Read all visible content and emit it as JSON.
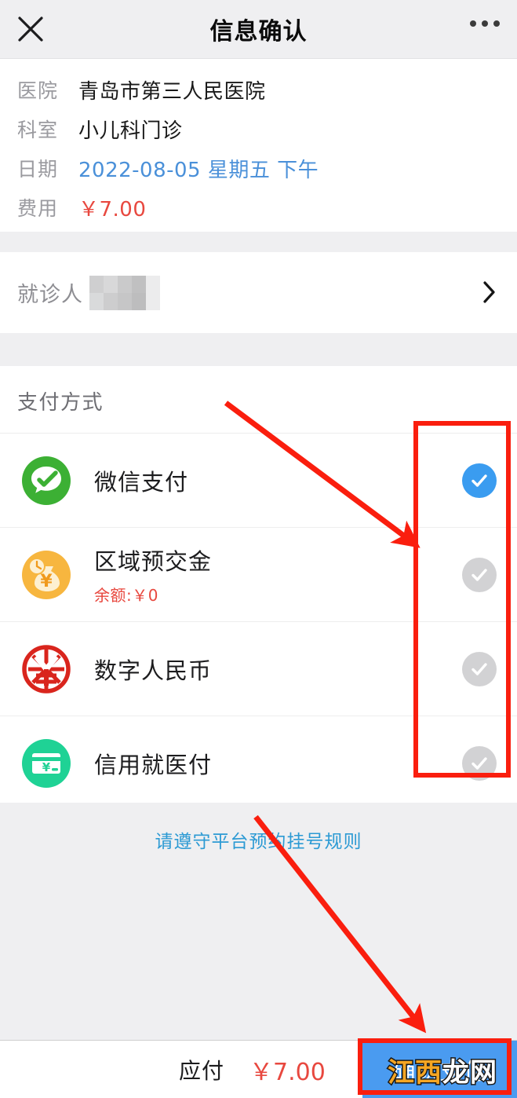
{
  "header": {
    "title": "信息确认",
    "close_icon": "close-icon",
    "more_icon": "more-options-icon"
  },
  "info": {
    "rows": [
      {
        "label": "医院",
        "value": "青岛市第三人民医院",
        "style": "plain"
      },
      {
        "label": "科室",
        "value": "小儿科门诊",
        "style": "plain"
      },
      {
        "label": "日期",
        "value": "2022-08-05 星期五 下午",
        "style": "blue"
      },
      {
        "label": "费用",
        "value": "￥7.00",
        "style": "red"
      }
    ]
  },
  "patient": {
    "label": "就诊人",
    "value": "",
    "chevron_icon": "chevron-right-icon"
  },
  "payment": {
    "section_title": "支付方式",
    "methods": [
      {
        "name": "微信支付",
        "sub": "",
        "icon": "wechat-pay-icon",
        "selected": true
      },
      {
        "name": "区域预交金",
        "sub": "余额:￥0",
        "icon": "prepaid-balance-icon",
        "selected": false
      },
      {
        "name": "数字人民币",
        "sub": "",
        "icon": "digital-rmb-icon",
        "selected": false
      },
      {
        "name": "信用就医付",
        "sub": "",
        "icon": "credit-medical-card-icon",
        "selected": false
      }
    ]
  },
  "rules_link": "请遵守平台预约挂号规则",
  "bottom": {
    "total_label": "应付",
    "total_amount": "￥7.00",
    "confirm_label": "确认支付"
  },
  "watermark": {
    "part1": "江西",
    "part2": "龙网"
  },
  "colors": {
    "accent_blue": "#4a9bf0",
    "link_blue": "#2c9ad4",
    "price_red": "#e8483f",
    "annotation_red": "#fa1e0e",
    "wechat_green": "#3cb034",
    "prepaid_orange": "#f6b042",
    "rmb_red": "#d9251d",
    "credit_green": "#1fd295",
    "page_bg": "#efeff1"
  }
}
